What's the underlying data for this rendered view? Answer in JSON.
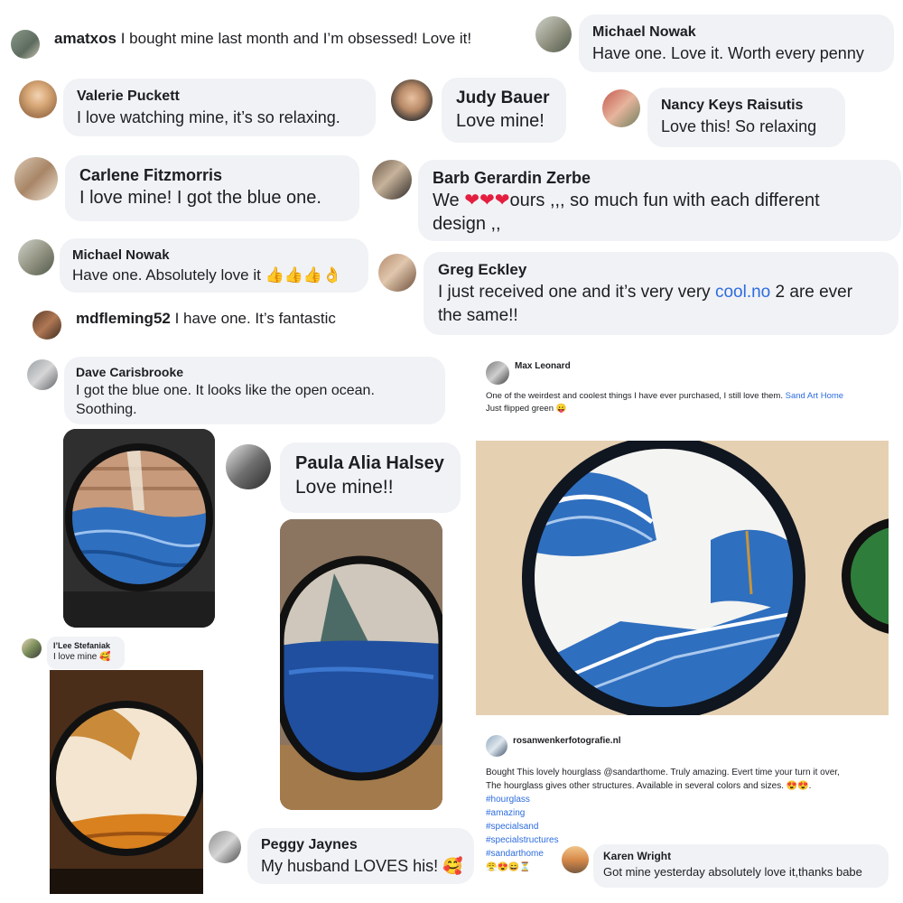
{
  "comments": {
    "amatxos": {
      "name": "amatxos",
      "text": "I bought mine last month and I’m obsessed! Love it!"
    },
    "michael_nowak_1": {
      "name": "Michael Nowak",
      "text": "Have one. Love it. Worth every penny"
    },
    "valerie": {
      "name": "Valerie Puckett",
      "text": "I love watching mine, it’s so relaxing."
    },
    "judy": {
      "name": "Judy Bauer",
      "text": "Love mine!"
    },
    "nancy": {
      "name": "Nancy Keys Raisutis",
      "text": "Love this! So relaxing"
    },
    "carlene": {
      "name": "Carlene Fitzmorris",
      "text": "I love mine! I got the blue one."
    },
    "barb": {
      "name": "Barb Gerardin Zerbe",
      "text_a": "We",
      "hearts": "❤❤❤",
      "text_b": "ours ,,, so much fun with each different",
      "text_c": "design ,,"
    },
    "michael_nowak_2": {
      "name": "Michael Nowak",
      "text": "Have one. Absolutely love it",
      "emoji": "👍👍👍👌"
    },
    "greg": {
      "name": "Greg Eckley",
      "text_a": "I just received one and it’s very very",
      "link": "cool.no",
      "text_b": "2 are ever",
      "text_c": "the same!!"
    },
    "mdfleming": {
      "name": "mdfleming52",
      "text": "I have one. It’s fantastic"
    },
    "dave": {
      "name": "Dave Carisbrooke",
      "text_a": "I got the blue one. It looks like the open ocean.",
      "text_b": "Soothing."
    },
    "paula": {
      "name": "Paula Alia Halsey",
      "text": "Love mine!!"
    },
    "ilee": {
      "name": "I’Lee Stefaniak",
      "text": "I love mine",
      "emoji": "🥰"
    },
    "peggy": {
      "name": "Peggy Jaynes",
      "text": "My husband LOVES his!",
      "emoji": "🥰"
    },
    "karen": {
      "name": "Karen Wright",
      "text": "Got mine yesterday absolutely love it,thanks babe"
    }
  },
  "post_max": {
    "name": "Max Leonard",
    "text": "One of the weirdest and coolest things I have ever purchased, I still love them.",
    "link": "Sand Art Home",
    "text2": "Just flipped green",
    "emoji": "😛"
  },
  "post_rosan": {
    "name": "rosanwenkerfotografie.nl",
    "line1": "Bought This lovely hourglass @sandarthome. Truly amazing. Evert time your turn it over,",
    "line2": "The hourglass gives other structures. Available in several colors and sizes.",
    "line2_emoji": "😍😍.",
    "hashtags": [
      "#hourglass",
      "#amazing",
      "#specialsand",
      "#specialstructures",
      "#sandarthome"
    ],
    "emoji_row": "😤😍😄⏳"
  },
  "colors": {
    "bubble": "#f0f2f5",
    "text": "#1c1e21",
    "link": "#2d6cdf",
    "heart": "#e41e3f",
    "sand_blue": "#2f6fbf",
    "sand_orange": "#d9801f"
  },
  "icons": [
    "profile-avatar"
  ]
}
